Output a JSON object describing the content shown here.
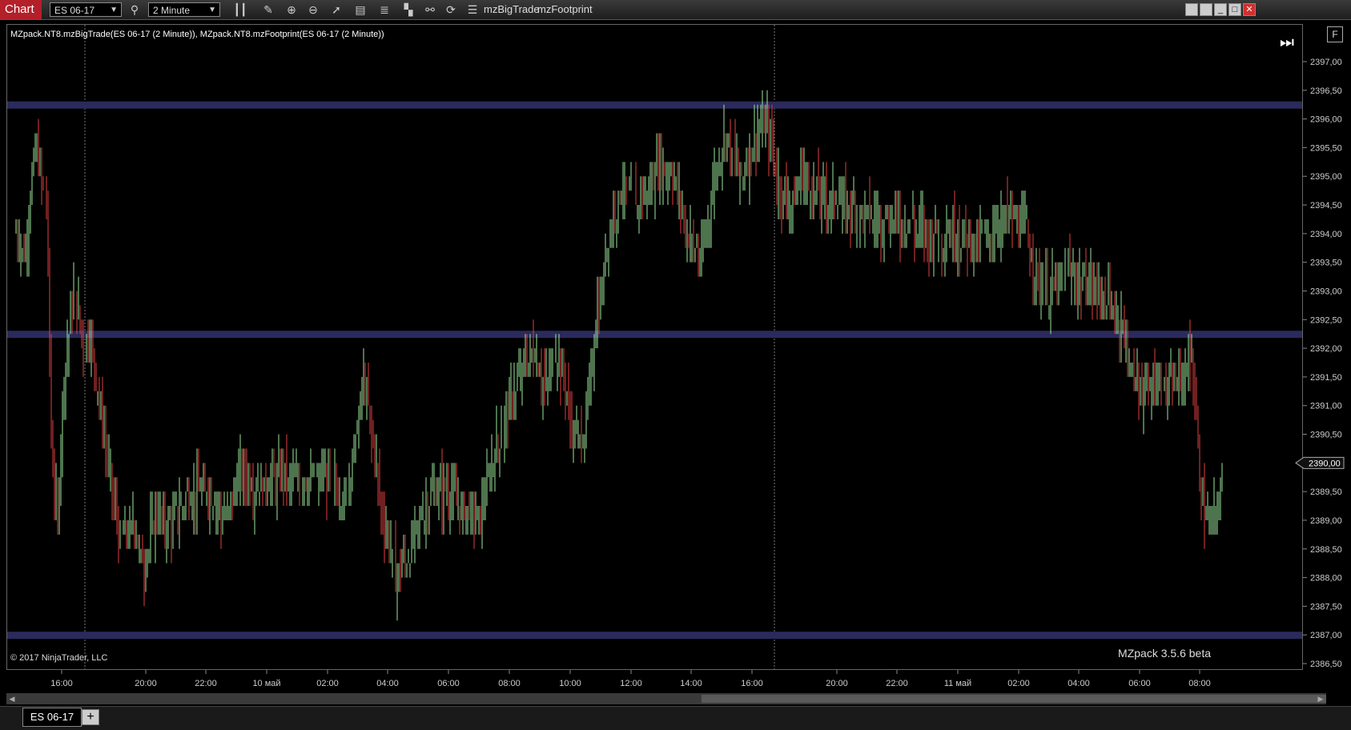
{
  "window": {
    "chart_tab": "Chart",
    "instrument": "ES 06-17",
    "interval": "2 Minute",
    "indicator_buttons": [
      "mzBigTrade",
      "mzFootprint"
    ]
  },
  "chart": {
    "indicator_label": "MZpack.NT8.mzBigTrade(ES 06-17 (2 Minute)), MZpack.NT8.mzFootprint(ES 06-17 (2 Minute))",
    "copyright": "© 2017 NinjaTrader, LLC",
    "watermark": "MZpack 3.5.6 beta",
    "current_price": "2390,00",
    "f_button": "F"
  },
  "bottom": {
    "tab": "ES 06-17",
    "add": "+"
  },
  "chart_data": {
    "type": "bar",
    "y_ticks": [
      "2397,00",
      "2396,50",
      "2396,00",
      "2395,50",
      "2395,00",
      "2394,50",
      "2394,00",
      "2393,50",
      "2393,00",
      "2392,50",
      "2392,00",
      "2391,50",
      "2391,00",
      "2390,50",
      "2390,00",
      "2389,50",
      "2389,00",
      "2388,50",
      "2388,00",
      "2387,50",
      "2387,00",
      "2386,50"
    ],
    "ylim": [
      2386.5,
      2397.0
    ],
    "x_ticks": [
      "16:00",
      "20:00",
      "22:00",
      "10 май",
      "02:00",
      "04:00",
      "06:00",
      "08:00",
      "10:00",
      "12:00",
      "14:00",
      "16:00",
      "20:00",
      "22:00",
      "11 май",
      "02:00",
      "04:00",
      "06:00",
      "08:00"
    ],
    "levels": [
      2396.25,
      2392.25,
      2387.0
    ],
    "colors": {
      "up": "#9be89b",
      "down": "#e04040",
      "level": "#2a2a5c",
      "grid_separator": "#777777"
    }
  }
}
